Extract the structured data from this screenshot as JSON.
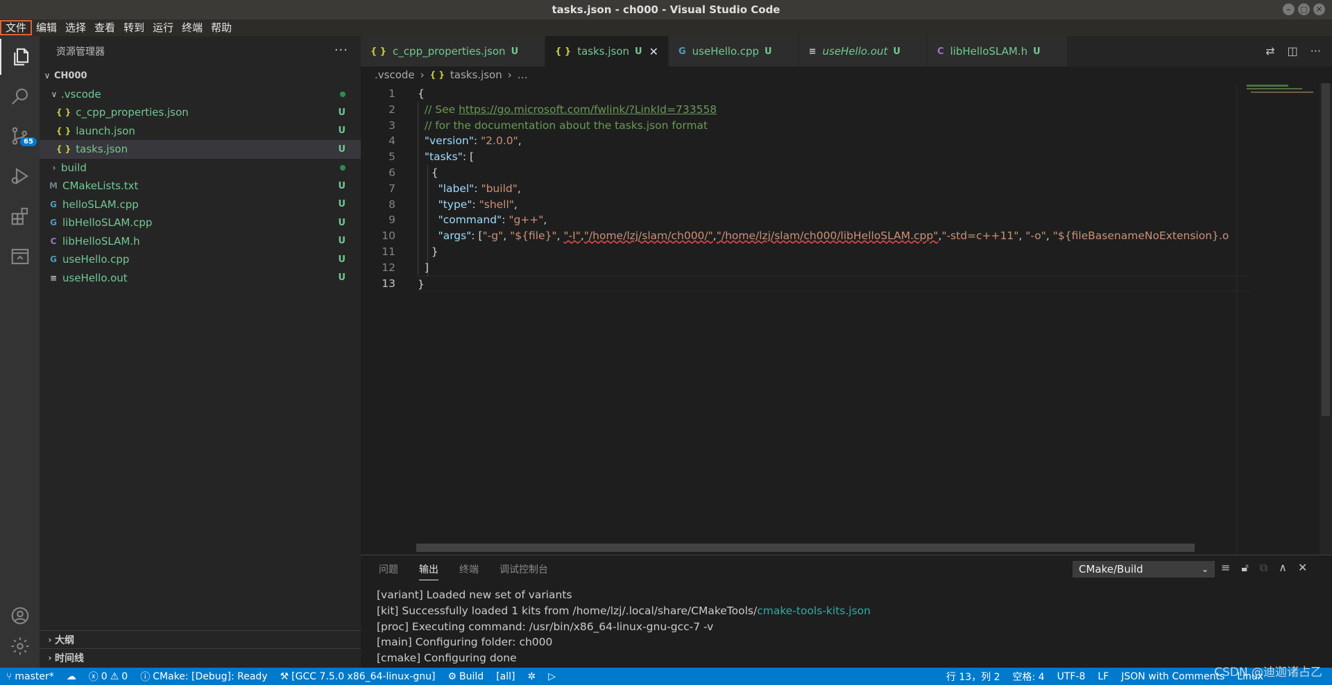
{
  "window": {
    "title": "tasks.json - ch000 - Visual Studio Code",
    "buttons": [
      "–",
      "□",
      "✕"
    ]
  },
  "menu": [
    "文件",
    "编辑",
    "选择",
    "查看",
    "转到",
    "运行",
    "终端",
    "帮助"
  ],
  "activity": {
    "scm_badge": "65"
  },
  "explorer": {
    "title": "资源管理器",
    "more": "···",
    "items": [
      {
        "label": "CH000",
        "depth": 0,
        "kind": "root",
        "chev": "∨",
        "status": ""
      },
      {
        "label": ".vscode",
        "depth": 1,
        "kind": "folder",
        "chev": "∨",
        "status": "dot"
      },
      {
        "label": "c_cpp_properties.json",
        "depth": 2,
        "kind": "json",
        "status": "U"
      },
      {
        "label": "launch.json",
        "depth": 2,
        "kind": "json",
        "status": "U"
      },
      {
        "label": "tasks.json",
        "depth": 2,
        "kind": "json",
        "status": "U",
        "selected": true
      },
      {
        "label": "build",
        "depth": 1,
        "kind": "folder",
        "chev": "›",
        "status": "dot"
      },
      {
        "label": "CMakeLists.txt",
        "depth": 1,
        "kind": "cmake",
        "status": "U"
      },
      {
        "label": "helloSLAM.cpp",
        "depth": 1,
        "kind": "cpp",
        "status": "U"
      },
      {
        "label": "libHelloSLAM.cpp",
        "depth": 1,
        "kind": "cpp",
        "status": "U"
      },
      {
        "label": "libHelloSLAM.h",
        "depth": 1,
        "kind": "h",
        "status": "U"
      },
      {
        "label": "useHello.cpp",
        "depth": 1,
        "kind": "cpp",
        "status": "U"
      },
      {
        "label": "useHello.out",
        "depth": 1,
        "kind": "out",
        "status": "U"
      }
    ],
    "outline": "大纲",
    "timeline": "时间线"
  },
  "tabs": [
    {
      "label": "c_cpp_properties.json",
      "kind": "json",
      "status": "U",
      "active": false,
      "italic": false
    },
    {
      "label": "tasks.json",
      "kind": "json",
      "status": "U",
      "active": true,
      "italic": false
    },
    {
      "label": "useHello.cpp",
      "kind": "cpp",
      "status": "U",
      "active": false,
      "italic": false
    },
    {
      "label": "useHello.out",
      "kind": "out",
      "status": "U",
      "active": false,
      "italic": true
    },
    {
      "label": "libHelloSLAM.h",
      "kind": "h",
      "status": "U",
      "active": false,
      "italic": false
    }
  ],
  "breadcrumb": {
    "folder": ".vscode",
    "file": "tasks.json",
    "tail": "…"
  },
  "editor": {
    "current_line": 13,
    "lines": [
      [
        [
          "p",
          "{"
        ]
      ],
      [
        [
          "c",
          "  // See "
        ],
        [
          "l",
          "https://go.microsoft.com/fwlink/?LinkId=733558"
        ]
      ],
      [
        [
          "c",
          "  // for the documentation about the tasks.json format"
        ]
      ],
      [
        [
          "p",
          "  "
        ],
        [
          "k",
          "\"version\""
        ],
        [
          "p",
          ": "
        ],
        [
          "s",
          "\"2.0.0\""
        ],
        [
          "p",
          ","
        ]
      ],
      [
        [
          "p",
          "  "
        ],
        [
          "k",
          "\"tasks\""
        ],
        [
          "p",
          ": ["
        ]
      ],
      [
        [
          "p",
          "    {"
        ]
      ],
      [
        [
          "p",
          "      "
        ],
        [
          "k",
          "\"label\""
        ],
        [
          "p",
          ": "
        ],
        [
          "s",
          "\"build\""
        ],
        [
          "p",
          ","
        ]
      ],
      [
        [
          "p",
          "      "
        ],
        [
          "k",
          "\"type\""
        ],
        [
          "p",
          ": "
        ],
        [
          "s",
          "\"shell\""
        ],
        [
          "p",
          ","
        ]
      ],
      [
        [
          "p",
          "      "
        ],
        [
          "k",
          "\"command\""
        ],
        [
          "p",
          ": "
        ],
        [
          "s",
          "\"g++\""
        ],
        [
          "p",
          ","
        ]
      ],
      [
        [
          "p",
          "      "
        ],
        [
          "k",
          "\"args\""
        ],
        [
          "p",
          ": ["
        ],
        [
          "s",
          "\"-g\""
        ],
        [
          "p",
          ", "
        ],
        [
          "s",
          "\"${file}\""
        ],
        [
          "p",
          ", "
        ],
        [
          "sq",
          "\"-I\""
        ],
        [
          "p",
          ","
        ],
        [
          "sq",
          "\"/home/lzj/slam/ch000/\""
        ],
        [
          "p",
          ","
        ],
        [
          "sq",
          "\"/home/lzj/slam/ch000/libHelloSLAM.cpp\""
        ],
        [
          "p",
          ","
        ],
        [
          "s",
          "\"-std=c++11\""
        ],
        [
          "p",
          ", "
        ],
        [
          "s",
          "\"-o\""
        ],
        [
          "p",
          ", "
        ],
        [
          "s",
          "\"${fileBasenameNoExtension}.o"
        ]
      ],
      [
        [
          "p",
          "    }"
        ]
      ],
      [
        [
          "p",
          "  ]"
        ]
      ],
      [
        [
          "p",
          "}"
        ]
      ]
    ]
  },
  "panel": {
    "tabs": [
      {
        "label": "问题",
        "active": false
      },
      {
        "label": "输出",
        "active": true
      },
      {
        "label": "终端",
        "active": false
      },
      {
        "label": "调试控制台",
        "active": false
      }
    ],
    "select": "CMake/Build",
    "output": [
      [
        [
          "t",
          "[variant] Loaded new set of variants"
        ]
      ],
      [
        [
          "t",
          "[kit] Successfully loaded 1 kits from /home/lzj/.local/share/CMakeTools/"
        ],
        [
          "teal",
          "cmake-tools-kits.json"
        ]
      ],
      [
        [
          "t",
          "[proc] Executing command: /usr/bin/x86_64-linux-gnu-gcc-7 -v"
        ]
      ],
      [
        [
          "t",
          "[main] Configuring folder: ch000"
        ]
      ],
      [
        [
          "t",
          "[cmake] Configuring done"
        ]
      ]
    ]
  },
  "status": {
    "branch": "master*",
    "errors": "0",
    "warnings": "0",
    "cmake": "CMake: [Debug]: Ready",
    "kit": "[GCC 7.5.0 x86_64-linux-gnu]",
    "build": "Build",
    "target": "[all]",
    "position": "行 13，列 2",
    "spaces": "空格: 4",
    "encoding": "UTF-8",
    "eol": "LF",
    "language": "JSON with Comments",
    "os": "Linux"
  },
  "watermark": "CSDN @迪迦诸占乙",
  "colors": {
    "accent": "#007acc",
    "untracked": "#73c991",
    "json_icon": "#cbcb41",
    "cpp_icon": "#519aba",
    "h_icon": "#a074c4",
    "cmake_icon": "#6d8086"
  }
}
